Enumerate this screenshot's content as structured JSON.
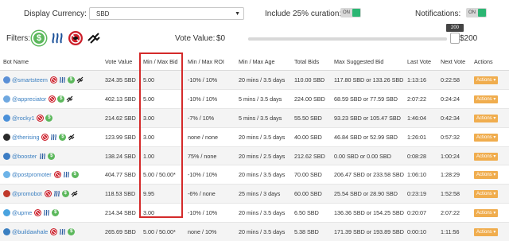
{
  "top": {
    "currency_label": "Display Currency:",
    "currency_value": "SBD",
    "curation_label": "Include 25% curation:",
    "curation_toggle": "ON",
    "notifications_label": "Notifications:",
    "notifications_toggle": "ON"
  },
  "filters": {
    "label": "Filters:",
    "icons": [
      "dollar-icon",
      "steem-icon",
      "ban-icon",
      "hand-icon"
    ]
  },
  "vote": {
    "label": "Vote Value:",
    "min": "$0",
    "max": "$200",
    "tooltip": "200",
    "level": 1.0
  },
  "table": {
    "headers": [
      "Bot Name",
      "Vote Value",
      "Min / Max Bid",
      "Min / Max ROI",
      "Min / Max Age",
      "Total Bids",
      "Max Suggested Bid",
      "Last Vote",
      "Next Vote",
      "Actions"
    ],
    "action_label": "Actions ▾",
    "rows": [
      {
        "name": "@smartsteem",
        "vote": "324.35 SBD",
        "bid": "5.00",
        "roi": "-10% / 10%",
        "age": "20 mins / 3.5 days",
        "total": "110.00 SBD",
        "suggested": "117.80 SBD or 133.26 SBD",
        "last": "1:13:16",
        "next": "0:22:58",
        "icons": [
          "ban",
          "steem",
          "dollar",
          "hand"
        ],
        "avatar": "#5a8fd6"
      },
      {
        "name": "@appreciator",
        "vote": "402.13 SBD",
        "bid": "5.00",
        "roi": "-10% / 10%",
        "age": "5 mins / 3.5 days",
        "total": "224.00 SBD",
        "suggested": "68.59 SBD or 77.59 SBD",
        "last": "2:07:22",
        "next": "0:24:24",
        "icons": [
          "ban",
          "dollar",
          "hand"
        ],
        "avatar": "#6fa8e0"
      },
      {
        "name": "@rocky1",
        "vote": "214.62 SBD",
        "bid": "3.00",
        "roi": "-7% / 10%",
        "age": "5 mins / 3.5 days",
        "total": "55.50 SBD",
        "suggested": "93.23 SBD or 105.47 SBD",
        "last": "1:46:04",
        "next": "0:42:34",
        "icons": [
          "ban",
          "dollar"
        ],
        "avatar": "#4a90d9"
      },
      {
        "name": "@therising",
        "vote": "123.99 SBD",
        "bid": "3.00",
        "roi": "none / none",
        "age": "20 mins / 3.5 days",
        "total": "40.00 SBD",
        "suggested": "46.84 SBD or 52.99 SBD",
        "last": "1:26:01",
        "next": "0:57:32",
        "icons": [
          "ban",
          "steem",
          "dollar",
          "hand"
        ],
        "avatar": "#2b2b2b"
      },
      {
        "name": "@booster",
        "vote": "138.24 SBD",
        "bid": "1.00",
        "roi": "75% / none",
        "age": "20 mins / 2.5 days",
        "total": "212.62 SBD",
        "suggested": "0.00 SBD or 0.00 SBD",
        "last": "0:08:28",
        "next": "1:00:24",
        "icons": [
          "steem",
          "dollar"
        ],
        "avatar": "#3c7dc4"
      },
      {
        "name": "@postpromoter",
        "vote": "404.77 SBD",
        "bid": "5.00 / 50.00*",
        "roi": "-10% / 10%",
        "age": "20 mins / 3.5 days",
        "total": "70.00 SBD",
        "suggested": "206.47 SBD or 233.58 SBD",
        "last": "1:06:10",
        "next": "1:28:29",
        "icons": [
          "ban",
          "steem",
          "dollar"
        ],
        "avatar": "#6db3e8"
      },
      {
        "name": "@promobot",
        "vote": "118.53 SBD",
        "bid": "9.95",
        "roi": "-6% / none",
        "age": "25 mins / 3 days",
        "total": "60.00 SBD",
        "suggested": "25.54 SBD or 28.90 SBD",
        "last": "0:23:19",
        "next": "1:52:58",
        "icons": [
          "ban",
          "steem",
          "dollar",
          "hand"
        ],
        "avatar": "#c0392b"
      },
      {
        "name": "@upme",
        "vote": "214.34 SBD",
        "bid": "3.00",
        "roi": "-10% / 10%",
        "age": "20 mins / 3.5 days",
        "total": "6.50 SBD",
        "suggested": "136.36 SBD or 154.25 SBD",
        "last": "0:20:07",
        "next": "2:07:22",
        "icons": [
          "ban",
          "steem",
          "dollar"
        ],
        "avatar": "#4aa3df"
      },
      {
        "name": "@buildawhale",
        "vote": "265.69 SBD",
        "bid": "5.00 / 50.00*",
        "roi": "none / 10%",
        "age": "20 mins / 3.5 days",
        "total": "5.38 SBD",
        "suggested": "171.39 SBD or 193.89 SBD",
        "last": "0:00:10",
        "next": "1:11:56",
        "icons": [
          "ban",
          "steem",
          "dollar"
        ],
        "avatar": "#3a7fc1"
      }
    ]
  },
  "colors": {
    "link": "#3a7fc1",
    "toggle_on": "#2bb673",
    "actions": "#f0ad4e",
    "highlight": "#d42a2a",
    "ban": "#cc1f2a",
    "dollar": "#5cb85c"
  }
}
